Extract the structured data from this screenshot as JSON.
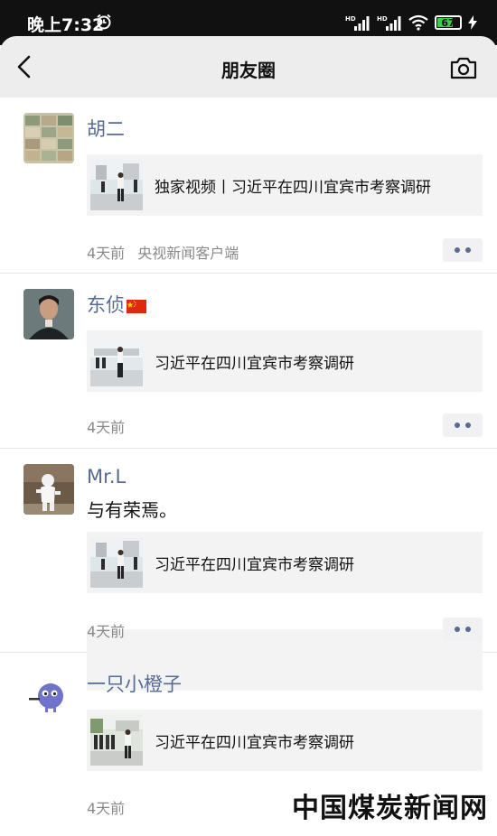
{
  "status_bar": {
    "time": "晚上7:32",
    "battery": "67",
    "icons": [
      "alarm-icon",
      "signal-hd-icon",
      "signal-hd-icon",
      "wifi-icon",
      "battery-icon",
      "charging-icon"
    ]
  },
  "nav": {
    "title": "朋友圈",
    "back_icon": "back-arrow-icon",
    "camera_icon": "camera-icon"
  },
  "posts": [
    {
      "name": "胡二",
      "link_title": "独家视频丨习近平在四川宜宾市考察调研",
      "time": "4天前",
      "source": "央视新闻客户端"
    },
    {
      "name": "东侦",
      "flag": "china-flag-icon",
      "link_title": "习近平在四川宜宾市考察调研",
      "time": "4天前"
    },
    {
      "name": "Mr.L",
      "text": "与有荣焉。",
      "link_title": "习近平在四川宜宾市考察调研",
      "time": "4天前"
    },
    {
      "name": "一只小橙子",
      "link_title": "习近平在四川宜宾市考察调研",
      "time": "4天前"
    }
  ],
  "watermark": "中国煤炭新闻网",
  "colors": {
    "name_link": "#576b95",
    "nav_bg": "#ededed",
    "status_bg": "#111111",
    "card_bg": "#f3f3f3"
  }
}
